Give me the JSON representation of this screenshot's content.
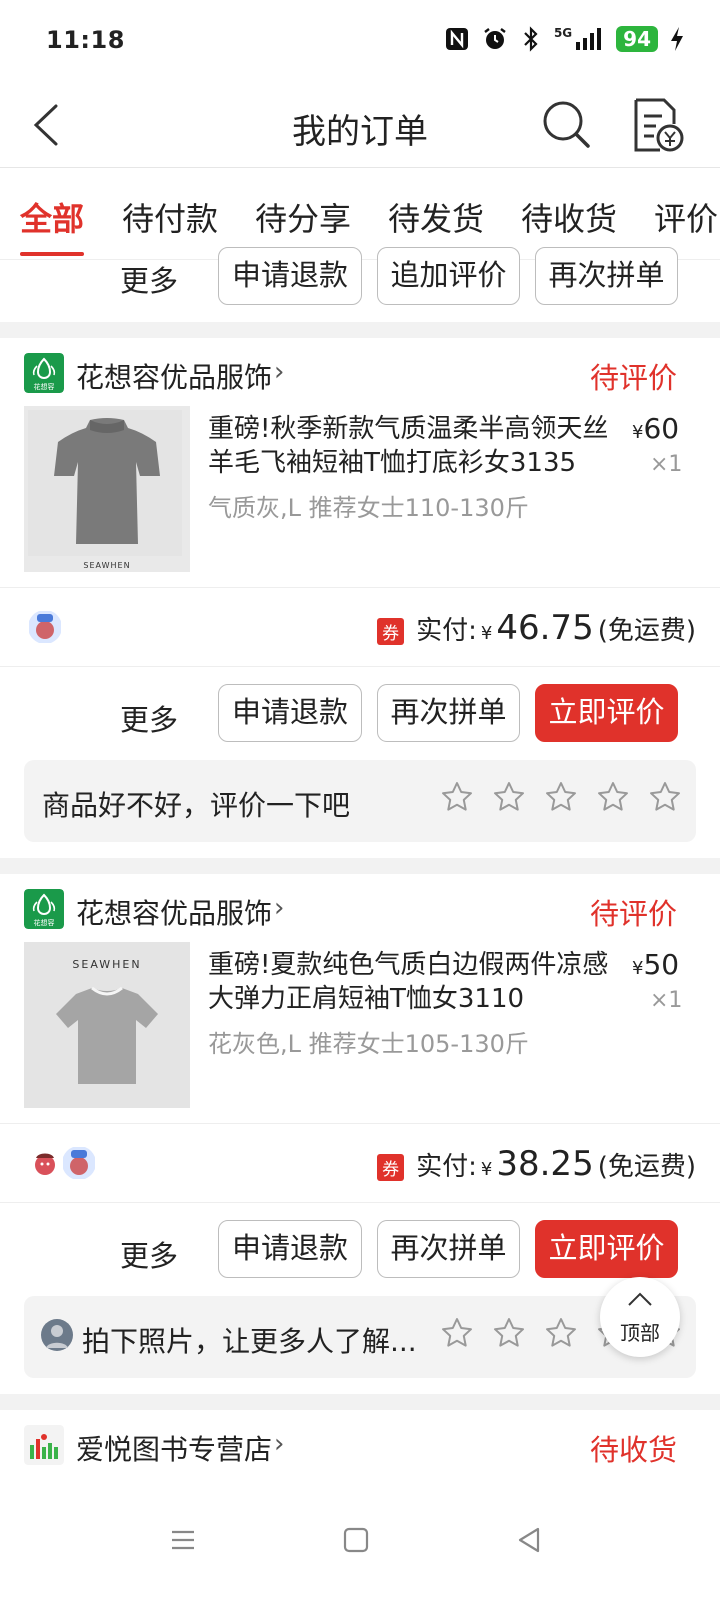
{
  "status_bar": {
    "time": "11:18",
    "battery": "94",
    "network": "5G"
  },
  "header": {
    "title": "我的订单"
  },
  "tabs": [
    "全部",
    "待付款",
    "待分享",
    "待发货",
    "待收货",
    "评价"
  ],
  "actions_top": {
    "more": "更多",
    "refund": "申请退款",
    "add_review": "追加评价",
    "reorder": "再次拼单"
  },
  "orders": [
    {
      "shop": "花想容优品服饰",
      "logo_text": "花想容",
      "status": "待评价",
      "product_title": "重磅!秋季新款气质温柔半高领天丝羊毛飞袖短袖T恤打底衫女3135",
      "spec": "气质灰,L 推荐女士110-130斤",
      "price": "60",
      "qty": "×1",
      "thumb_brand": "SEAWHEN",
      "coupon": "券",
      "paid_label": "实付:",
      "paid": "46.75",
      "shipping": "(免运费)",
      "more": "更多",
      "refund": "申请退款",
      "reorder": "再次拼单",
      "review": "立即评价",
      "prompt": "商品好不好，评价一下吧"
    },
    {
      "shop": "花想容优品服饰",
      "logo_text": "花想容",
      "status": "待评价",
      "product_title": "重磅!夏款纯色气质白边假两件凉感大弹力正肩短袖T恤女3110",
      "spec": "花灰色,L 推荐女士105-130斤",
      "price": "50",
      "qty": "×1",
      "thumb_brand": "SEAWHEN",
      "coupon": "券",
      "paid_label": "实付:",
      "paid": "38.25",
      "shipping": "(免运费)",
      "more": "更多",
      "refund": "申请退款",
      "reorder": "再次拼单",
      "review": "立即评价",
      "prompt": "拍下照片，让更多人了解..."
    },
    {
      "shop": "爱悦图书专营店",
      "status": "待收货"
    }
  ],
  "currency": "¥",
  "top_button": "顶部",
  "colors": {
    "accent": "#e0322b",
    "brand_green": "#1a9a4a"
  }
}
